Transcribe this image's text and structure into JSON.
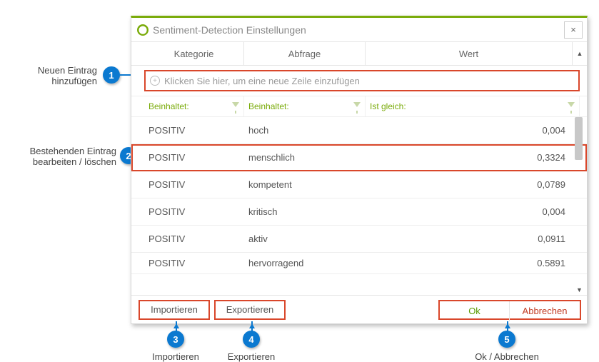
{
  "dialog": {
    "title": "Sentiment-Detection Einstellungen",
    "close_label": "×"
  },
  "columns": {
    "c1": "Kategorie",
    "c2": "Abfrage",
    "c3": "Wert"
  },
  "newrow": {
    "hint": "Klicken Sie hier, um eine neue Zeile einzufügen"
  },
  "filters": {
    "f1": "Beinhaltet:",
    "f2": "Beinhaltet:",
    "f3": "Ist gleich:"
  },
  "rows": [
    {
      "cat": "POSITIV",
      "abf": "hoch",
      "wert": "0,004"
    },
    {
      "cat": "POSITIV",
      "abf": "menschlich",
      "wert": "0,3324"
    },
    {
      "cat": "POSITIV",
      "abf": "kompetent",
      "wert": "0,0789"
    },
    {
      "cat": "POSITIV",
      "abf": "kritisch",
      "wert": "0,004"
    },
    {
      "cat": "POSITIV",
      "abf": "aktiv",
      "wert": "0,0911"
    },
    {
      "cat": "POSITIV",
      "abf": "hervorragend",
      "wert": "0.5891"
    }
  ],
  "footer": {
    "import": "Importieren",
    "export": "Exportieren",
    "ok": "Ok",
    "cancel": "Abbrechen"
  },
  "annotations": {
    "a1": "Neuen Eintrag hinzufügen",
    "a1b": "hinzufügen",
    "a2": "Bestehenden Eintrag bearbeiten / löschen",
    "a3": "Importieren",
    "a4": "Exportieren",
    "a5": "Ok / Abbrechen",
    "n1": "1",
    "n2": "2",
    "n3": "3",
    "n4": "4",
    "n5": "5"
  }
}
